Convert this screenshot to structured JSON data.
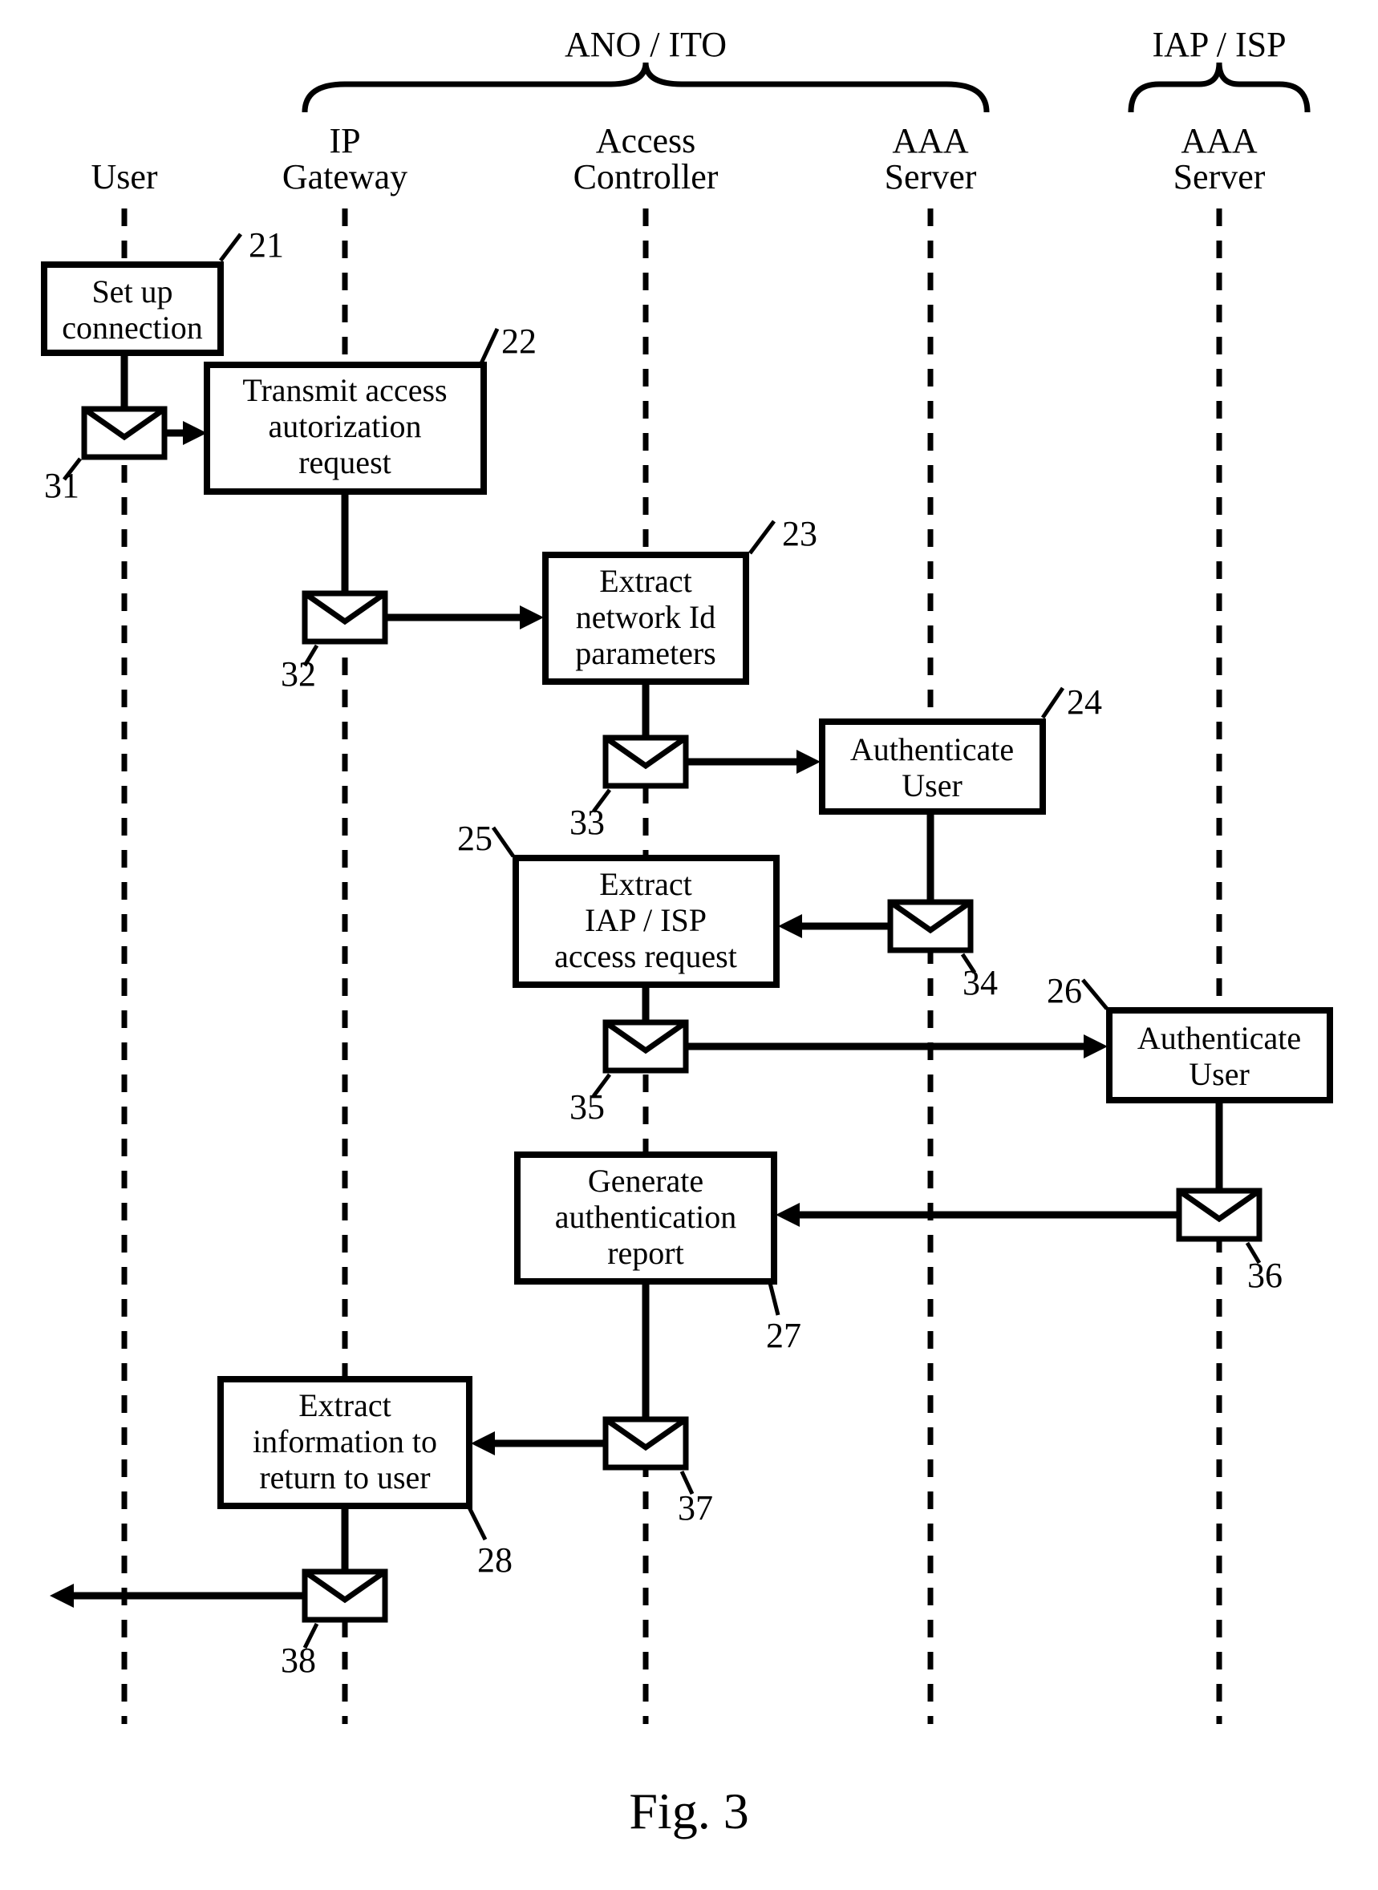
{
  "groups": {
    "left": "ANO / ITO",
    "right": "IAP / ISP"
  },
  "lanes": {
    "user": "User",
    "ip_gateway_l1": "IP",
    "ip_gateway_l2": "Gateway",
    "access_ctrl_l1": "Access",
    "access_ctrl_l2": "Controller",
    "aaa1_l1": "AAA",
    "aaa1_l2": "Server",
    "aaa2_l1": "AAA",
    "aaa2_l2": "Server"
  },
  "boxes": {
    "b21_l1": "Set up",
    "b21_l2": "connection",
    "b22_l1": "Transmit access",
    "b22_l2": "autorization",
    "b22_l3": "request",
    "b23_l1": "Extract",
    "b23_l2": "network Id",
    "b23_l3": "parameters",
    "b24_l1": "Authenticate",
    "b24_l2": "User",
    "b25_l1": "Extract",
    "b25_l2": "IAP / ISP",
    "b25_l3": "access request",
    "b26_l1": "Authenticate",
    "b26_l2": "User",
    "b27_l1": "Generate",
    "b27_l2": "authentication",
    "b27_l3": "report",
    "b28_l1": "Extract",
    "b28_l2": "information to",
    "b28_l3": "return to user"
  },
  "numbers": {
    "n21": "21",
    "n22": "22",
    "n23": "23",
    "n24": "24",
    "n25": "25",
    "n26": "26",
    "n27": "27",
    "n28": "28",
    "n31": "31",
    "n32": "32",
    "n33": "33",
    "n34": "34",
    "n35": "35",
    "n36": "36",
    "n37": "37",
    "n38": "38"
  },
  "figure": "Fig. 3"
}
